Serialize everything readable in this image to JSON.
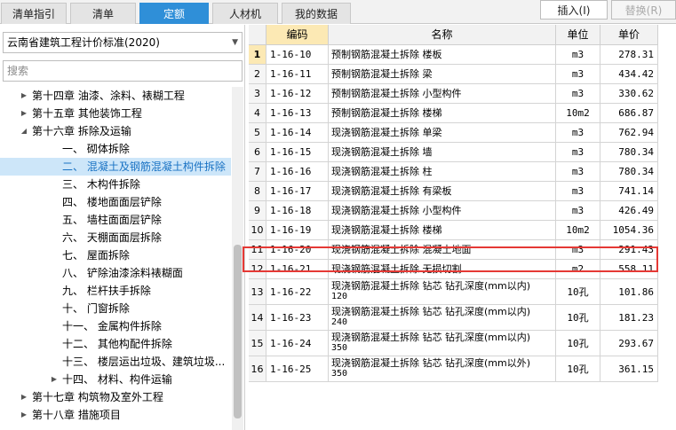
{
  "tabs": [
    {
      "label": "清单指引"
    },
    {
      "label": "清单"
    },
    {
      "label": "定额"
    },
    {
      "label": "人材机"
    },
    {
      "label": "我的数据"
    }
  ],
  "active_tab": "定额",
  "toolbar": {
    "insert_label": "插入(I)",
    "replace_label": "替换(R)"
  },
  "library": {
    "selected": "云南省建筑工程计价标准(2020)"
  },
  "search": {
    "placeholder": "搜索"
  },
  "tree": [
    {
      "label": "第十四章 油漆、涂料、裱糊工程",
      "level": 0,
      "state": "collapsed"
    },
    {
      "label": "第十五章 其他装饰工程",
      "level": 0,
      "state": "collapsed"
    },
    {
      "label": "第十六章 拆除及运输",
      "level": 0,
      "state": "expanded"
    },
    {
      "label": "一、 砌体拆除",
      "level": 1
    },
    {
      "label": "二、 混凝土及钢筋混凝土构件拆除",
      "level": 1,
      "selected": true
    },
    {
      "label": "三、 木构件拆除",
      "level": 1
    },
    {
      "label": "四、 楼地面面层铲除",
      "level": 1
    },
    {
      "label": "五、 墙柱面面层铲除",
      "level": 1
    },
    {
      "label": "六、 天棚面面层拆除",
      "level": 1
    },
    {
      "label": "七、 屋面拆除",
      "level": 1
    },
    {
      "label": "八、 铲除油漆涂料裱糊面",
      "level": 1
    },
    {
      "label": "九、 栏杆扶手拆除",
      "level": 1
    },
    {
      "label": "十、 门窗拆除",
      "level": 1
    },
    {
      "label": "十一、 金属构件拆除",
      "level": 1
    },
    {
      "label": "十二、 其他构配件拆除",
      "level": 1
    },
    {
      "label": "十三、 楼层运出垃圾、建筑垃圾...",
      "level": 1
    },
    {
      "label": "十四、 材料、构件运输",
      "level": 1,
      "state": "collapsed"
    },
    {
      "label": "第十七章 构筑物及室外工程",
      "level": 0,
      "state": "collapsed"
    },
    {
      "label": "第十八章 措施项目",
      "level": 0,
      "state": "collapsed"
    }
  ],
  "grid": {
    "headers": {
      "code": "编码",
      "name": "名称",
      "unit": "单位",
      "price": "单价"
    },
    "rows": [
      {
        "no": "1",
        "code": "1-16-10",
        "name": "预制钢筋混凝土拆除 楼板",
        "unit": "m3",
        "price": "278.31"
      },
      {
        "no": "2",
        "code": "1-16-11",
        "name": "预制钢筋混凝土拆除 梁",
        "unit": "m3",
        "price": "434.42"
      },
      {
        "no": "3",
        "code": "1-16-12",
        "name": "预制钢筋混凝土拆除 小型构件",
        "unit": "m3",
        "price": "330.62"
      },
      {
        "no": "4",
        "code": "1-16-13",
        "name": "预制钢筋混凝土拆除 楼梯",
        "unit": "10m2",
        "price": "686.87"
      },
      {
        "no": "5",
        "code": "1-16-14",
        "name": "现浇钢筋混凝土拆除 单梁",
        "unit": "m3",
        "price": "762.94"
      },
      {
        "no": "6",
        "code": "1-16-15",
        "name": "现浇钢筋混凝土拆除 墙",
        "unit": "m3",
        "price": "780.34"
      },
      {
        "no": "7",
        "code": "1-16-16",
        "name": "现浇钢筋混凝土拆除 柱",
        "unit": "m3",
        "price": "780.34"
      },
      {
        "no": "8",
        "code": "1-16-17",
        "name": "现浇钢筋混凝土拆除 有梁板",
        "unit": "m3",
        "price": "741.14"
      },
      {
        "no": "9",
        "code": "1-16-18",
        "name": "现浇钢筋混凝土拆除 小型构件",
        "unit": "m3",
        "price": "426.49"
      },
      {
        "no": "10",
        "code": "1-16-19",
        "name": "现浇钢筋混凝土拆除 楼梯",
        "unit": "10m2",
        "price": "1054.36"
      },
      {
        "no": "11",
        "code": "1-16-20",
        "name": "现浇钢筋混凝土拆除 混凝土地面",
        "unit": "m3",
        "price": "291.43",
        "highlight": true
      },
      {
        "no": "12",
        "code": "1-16-21",
        "name": "现浇钢筋混凝土拆除 无损切割",
        "unit": "m2",
        "price": "558.11"
      },
      {
        "no": "13",
        "code": "1-16-22",
        "name": "现浇钢筋混凝土拆除 钻芯 钻孔深度(mm以内)",
        "sub": "120",
        "unit": "10孔",
        "price": "101.86"
      },
      {
        "no": "14",
        "code": "1-16-23",
        "name": "现浇钢筋混凝土拆除 钻芯 钻孔深度(mm以内)",
        "sub": "240",
        "unit": "10孔",
        "price": "181.23"
      },
      {
        "no": "15",
        "code": "1-16-24",
        "name": "现浇钢筋混凝土拆除 钻芯 钻孔深度(mm以内)",
        "sub": "350",
        "unit": "10孔",
        "price": "293.67"
      },
      {
        "no": "16",
        "code": "1-16-25",
        "name": "现浇钢筋混凝土拆除 钻芯 钻孔深度(mm以外)",
        "sub": "350",
        "unit": "10孔",
        "price": "361.15"
      }
    ]
  },
  "colors": {
    "active_tab": "#2f8fd8",
    "selected_row": "#cde6f9",
    "highlight_border": "#e53935",
    "header_highlight": "#fce9b4"
  }
}
